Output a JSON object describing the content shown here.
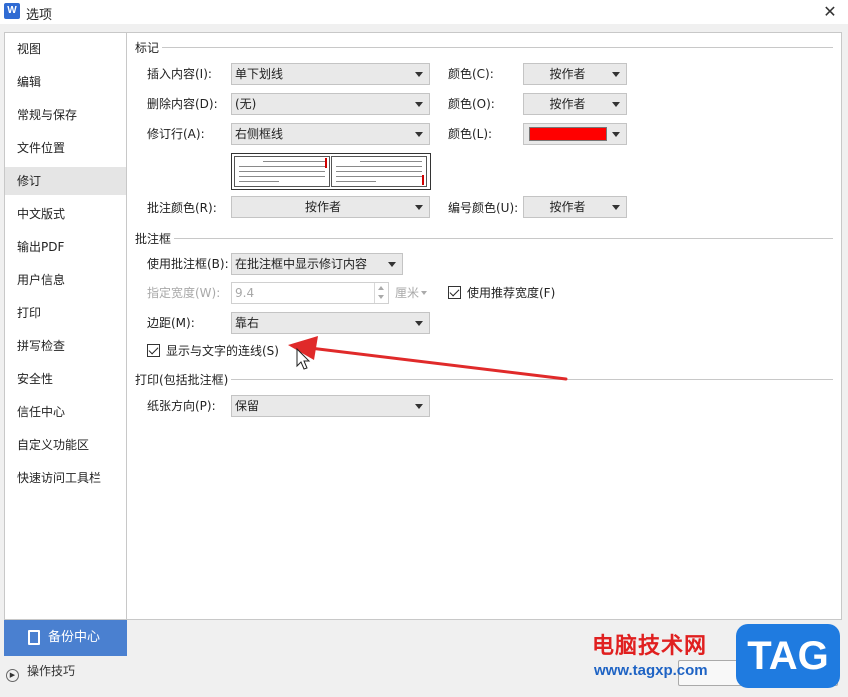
{
  "window": {
    "title": "选项",
    "app_icon": "W"
  },
  "sidebar": {
    "items": [
      {
        "label": "视图"
      },
      {
        "label": "编辑"
      },
      {
        "label": "常规与保存"
      },
      {
        "label": "文件位置"
      },
      {
        "label": "修订",
        "active": true
      },
      {
        "label": "中文版式"
      },
      {
        "label": "输出PDF"
      },
      {
        "label": "用户信息"
      },
      {
        "label": "打印"
      },
      {
        "label": "拼写检查"
      },
      {
        "label": "安全性"
      },
      {
        "label": "信任中心"
      },
      {
        "label": "自定义功能区"
      },
      {
        "label": "快速访问工具栏"
      }
    ],
    "backup_button": "备份中心",
    "tips_link": "操作技巧"
  },
  "marks": {
    "section_title": "标记",
    "insert": {
      "label": "插入内容(I):",
      "value": "单下划线",
      "color_label": "颜色(C):",
      "color_value": "按作者"
    },
    "delete": {
      "label": "删除内容(D):",
      "value": "(无)",
      "color_label": "颜色(O):",
      "color_value": "按作者"
    },
    "revision_line": {
      "label": "修订行(A):",
      "value": "右侧框线",
      "color_label": "颜色(L):",
      "swatch_color": "#ff0000"
    },
    "comment_color": {
      "label": "批注颜色(R):",
      "value": "按作者"
    },
    "number_color": {
      "label": "编号颜色(U):",
      "value": "按作者"
    }
  },
  "balloons": {
    "section_title": "批注框",
    "use_balloons": {
      "label": "使用批注框(B):",
      "value": "在批注框中显示修订内容"
    },
    "width": {
      "label": "指定宽度(W):",
      "value": "9.4",
      "unit": "厘米"
    },
    "recommended_width": {
      "label": "使用推荐宽度(F)",
      "checked": true
    },
    "margin": {
      "label": "边距(M):",
      "value": "靠右"
    },
    "show_lines": {
      "label": "显示与文字的连线(S)",
      "checked": true
    }
  },
  "print": {
    "section_title": "打印(包括批注框)",
    "paper_orientation": {
      "label": "纸张方向(P):",
      "value": "保留"
    }
  },
  "watermark": {
    "text": "电脑技术网",
    "url": "www.tagxp.com",
    "tag": "TAG"
  },
  "colors": {
    "accent": "#4a80d0",
    "annotation_arrow": "#e02a2a",
    "watermark_red": "#e02020",
    "watermark_blue": "#1f7be0"
  }
}
